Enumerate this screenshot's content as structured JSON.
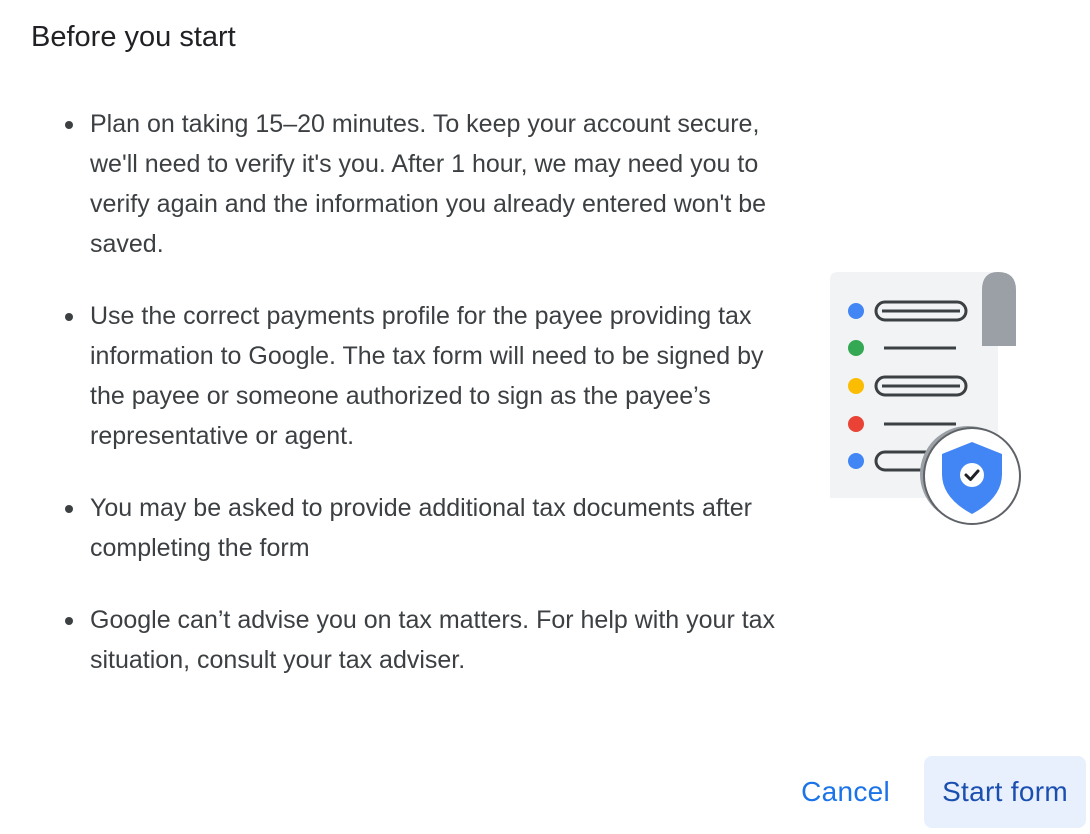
{
  "dialog": {
    "title": "Before you start",
    "bullets": [
      "Plan on taking 15–20 minutes. To keep your account secure, we'll need to verify it's you. After 1 hour, we may need you to verify again and the information you already entered won't be saved.",
      "Use the correct payments profile for the payee providing tax information to Google. The tax form will need to be signed by the payee or someone authorized to sign as the payee’s representative or agent.",
      "You may be asked to provide additional tax documents after completing the form",
      "Google can’t advise you on tax matters. For help with your tax situation, consult your tax adviser."
    ],
    "illustration": {
      "icon": "document-shield-icon",
      "dot_colors": [
        "#4285f4",
        "#34a853",
        "#fbbc04",
        "#ea4335",
        "#4285f4"
      ],
      "shield_color": "#4285f4"
    },
    "actions": {
      "cancel_label": "Cancel",
      "start_label": "Start form"
    }
  },
  "colors": {
    "accent": "#1a73e8",
    "primary_button_bg": "#e8f0fe",
    "text": "#3c4043"
  }
}
